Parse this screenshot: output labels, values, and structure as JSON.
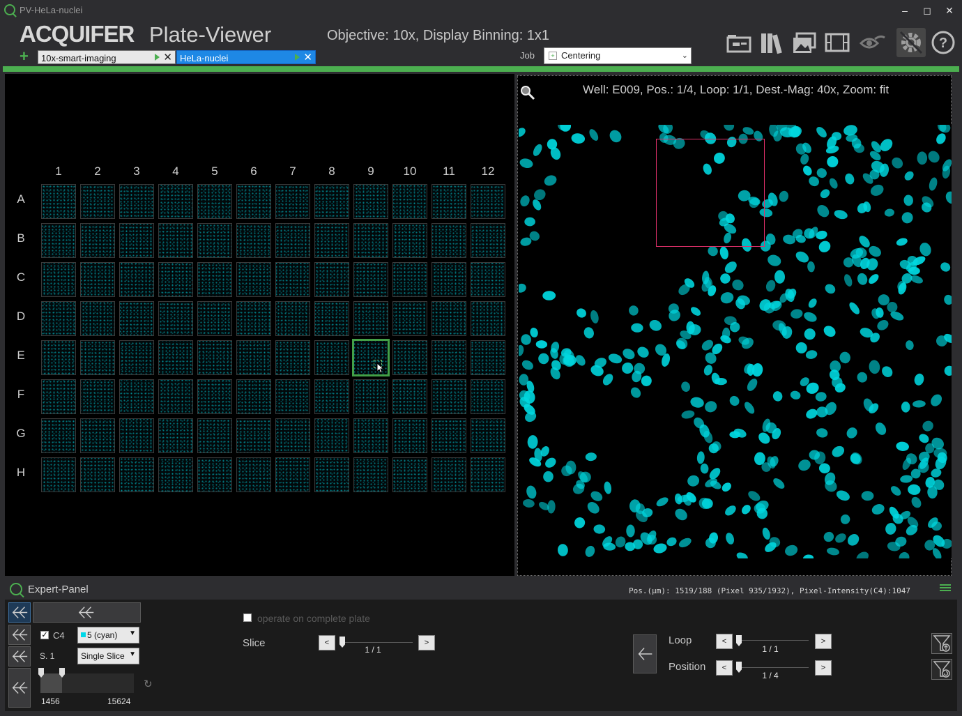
{
  "window": {
    "title": "PV-HeLa-nuclei"
  },
  "header": {
    "logo": "ACQUIFER",
    "app_name": "Plate-Viewer",
    "objective_text": "Objective: 10x, Display Binning: 1x1",
    "job_label": "Job",
    "job_selected": "Centering"
  },
  "tabs": [
    {
      "label": "10x-smart-imaging",
      "active": false
    },
    {
      "label": "HeLa-nuclei",
      "active": true
    }
  ],
  "toolbar": [
    "folder-icon",
    "library-icon",
    "images-icon",
    "film-icon",
    "eye-icon",
    "settings-icon",
    "help-icon"
  ],
  "plate": {
    "columns": [
      "1",
      "2",
      "3",
      "4",
      "5",
      "6",
      "7",
      "8",
      "9",
      "10",
      "11",
      "12"
    ],
    "rows": [
      "A",
      "B",
      "C",
      "D",
      "E",
      "F",
      "G",
      "H"
    ],
    "selected_well": "E009"
  },
  "viewer": {
    "info": "Well: E009, Pos.: 1/4, Loop: 1/1, Dest.-Mag: 40x, Zoom: fit",
    "nucleus_color": "#00d8e0"
  },
  "expert": {
    "title": "Expert-Panel",
    "pos_readout": "Pos.(µm): 1519/188 (Pixel 935/1932), Pixel-Intensity(C4):1047",
    "channel_label": "C4",
    "channel_checked": true,
    "lut_value": "5 (cyan)",
    "slice_short": "S. 1",
    "slice_mode": "Single Slice",
    "range_min": "1456",
    "range_max": "15624",
    "operate_label": "operate on complete plate",
    "slice_label": "Slice",
    "slice_value": "1 / 1",
    "loop_label": "Loop",
    "loop_value": "1 / 1",
    "position_label": "Position",
    "position_value": "1 / 4",
    "prev": "<",
    "next": ">"
  },
  "colors": {
    "accent": "#4caf50",
    "tab_active": "#1e88e5",
    "roi": "#e0306a"
  }
}
